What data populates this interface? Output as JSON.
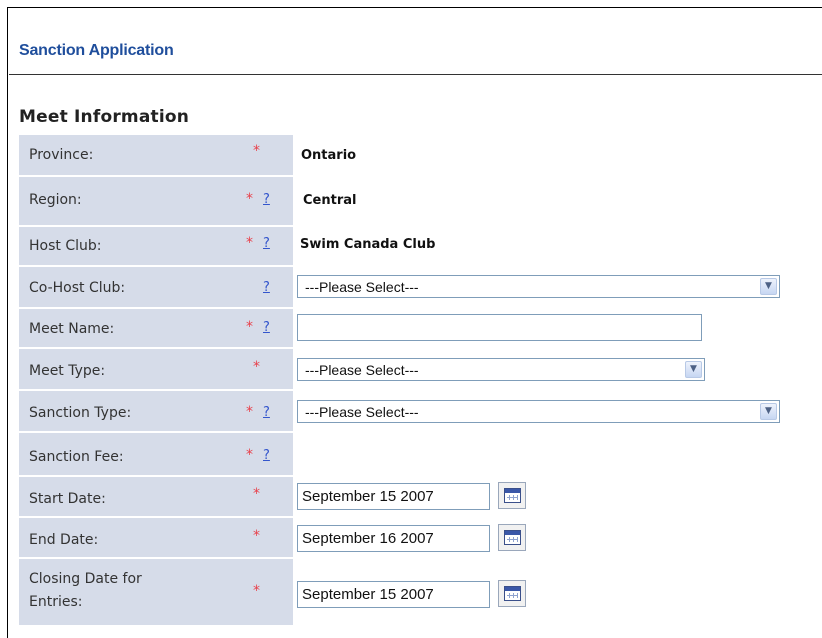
{
  "page": {
    "title": "Sanction Application",
    "section_title": "Meet Information"
  },
  "form": {
    "required_mark": "*",
    "help_mark": "?",
    "province": {
      "label": "Province:",
      "value": "Ontario"
    },
    "region": {
      "label": "Region:",
      "value": "Central"
    },
    "host_club": {
      "label": "Host Club:",
      "value": "Swim Canada Club"
    },
    "co_host_club": {
      "label": "Co-Host Club:",
      "selected": "---Please Select---"
    },
    "meet_name": {
      "label": "Meet Name:",
      "value": ""
    },
    "meet_type": {
      "label": "Meet Type:",
      "selected": "---Please Select---"
    },
    "sanction_type": {
      "label": "Sanction Type:",
      "selected": "---Please Select---"
    },
    "sanction_fee": {
      "label": "Sanction Fee:"
    },
    "start_date": {
      "label": "Start Date:",
      "value": "September 15 2007"
    },
    "end_date": {
      "label": "End Date:",
      "value": "September 16 2007"
    },
    "closing_date": {
      "label_line1": "Closing Date for",
      "label_line2": "Entries:",
      "value": "September 15 2007"
    }
  },
  "icons": {
    "dropdown": "chevron-down-icon",
    "calendar": "calendar-icon"
  },
  "colors": {
    "title": "#1f4e9c",
    "label_background": "#d6dce9",
    "required": "#e8404a",
    "help_link": "#3355cc"
  }
}
